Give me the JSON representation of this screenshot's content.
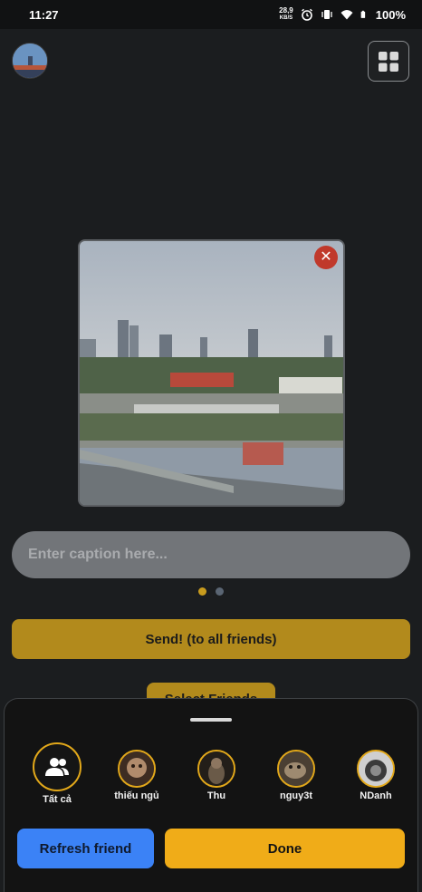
{
  "status_bar": {
    "time": "11:27",
    "speed_value": "28,9",
    "speed_unit": "KB/S",
    "battery": "100%"
  },
  "header": {
    "avatar_icon": "profile-avatar",
    "grid_icon": "grid-icon"
  },
  "photo": {
    "description_icon": "city-photo",
    "close_icon": "close-icon",
    "close_glyph": "✕"
  },
  "caption": {
    "placeholder": "Enter caption here...",
    "value": ""
  },
  "pager": {
    "count": 2,
    "active": 0,
    "active_color": "#c89b1e",
    "inactive_color": "#5a6573"
  },
  "send_label": "Send! (to all friends)",
  "select_friends_label": "Select Friends",
  "bottom_sheet": {
    "friends": [
      {
        "name": "Tất cả",
        "icon": "group-icon"
      },
      {
        "name": "thiếu ngủ",
        "icon": "friend-avatar"
      },
      {
        "name": "Thu",
        "icon": "friend-avatar"
      },
      {
        "name": "nguy3t",
        "icon": "friend-avatar"
      },
      {
        "name": "NDanh",
        "icon": "friend-avatar"
      }
    ],
    "refresh_label": "Refresh friend",
    "done_label": "Done"
  },
  "colors": {
    "accent": "#f0ac18",
    "accent_dim": "#b28a1c",
    "blue": "#3b82f6",
    "background": "#1b1d1f"
  }
}
